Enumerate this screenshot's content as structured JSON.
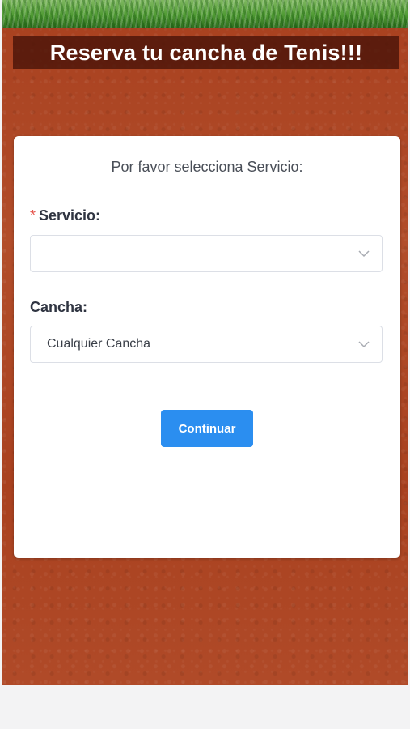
{
  "header": {
    "title": "Reserva tu cancha de Tenis!!!"
  },
  "form": {
    "prompt": "Por favor selecciona Servicio:",
    "servicio": {
      "required_marker": "*",
      "label": "Servicio:",
      "value": ""
    },
    "cancha": {
      "label": "Cancha:",
      "value": "Cualquier Cancha"
    },
    "continue_label": "Continuar"
  },
  "icons": {
    "servicio_dropdown": "chevron-down-icon",
    "cancha_dropdown": "chevron-down-icon"
  },
  "colors": {
    "clay": "#a8401f",
    "grass": "#4f9a33",
    "title_bg": "#46120a",
    "primary_button": "#2b8ef0",
    "required": "#e5574f"
  }
}
